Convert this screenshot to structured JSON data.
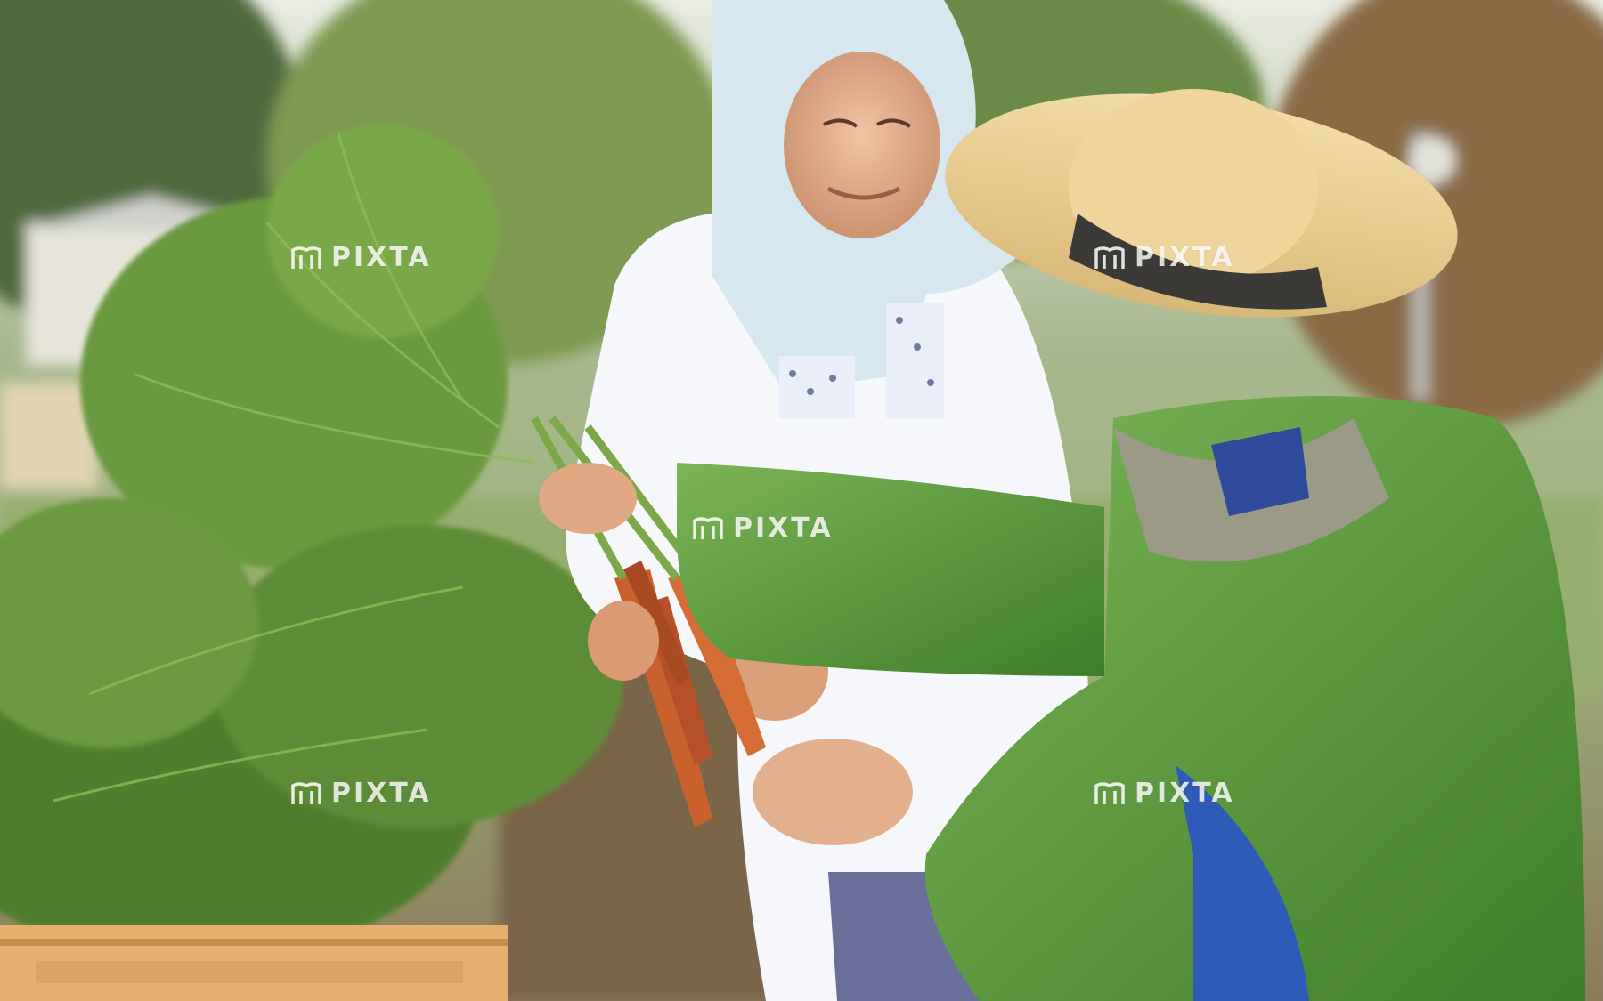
{
  "image": {
    "description_colors": {
      "sky": "#e7eadf",
      "foliage": "#6f9a4c",
      "jacket_green": "#5f9f3e",
      "hat_straw": "#e9cf96",
      "bonnet_blue": "#d9e8ef",
      "carrot": "#c9612c",
      "crate": "#e6b070"
    }
  },
  "watermarks": [
    {
      "text": "PIXTA"
    },
    {
      "text": "PIXTA"
    },
    {
      "text": "PIXTA"
    },
    {
      "text": "PIXTA"
    },
    {
      "text": "PIXTA"
    }
  ],
  "icons": {
    "watermark_logo": "pixta-logo-icon"
  }
}
